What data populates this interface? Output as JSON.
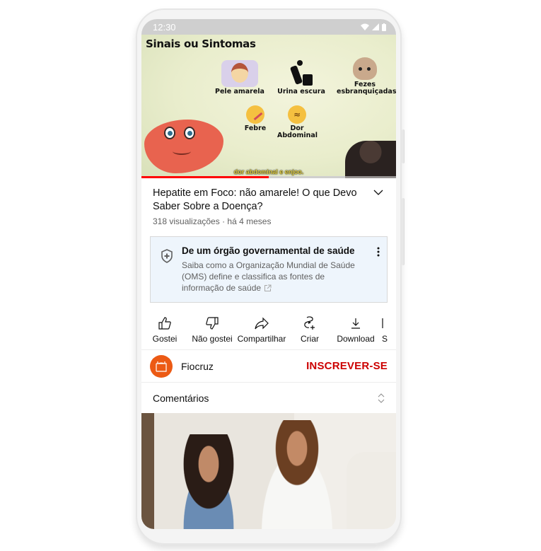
{
  "status_bar": {
    "time": "12:30",
    "icons": [
      "wifi-icon",
      "signal-icon",
      "battery-icon"
    ]
  },
  "video": {
    "slide_title": "Sinais ou Sintomas",
    "symptoms": [
      {
        "label": "Pele amarela",
        "icon": "yellow-skin-illustration"
      },
      {
        "label": "Urina escura",
        "icon": "toilet-person-icon"
      },
      {
        "label_line1": "Fezes",
        "label_line2": "esbranquiçadas",
        "icon": "poop-icon"
      },
      {
        "label": "Febre",
        "icon": "thermometer-face-icon"
      },
      {
        "label_line1": "Dor",
        "label_line2": "Abdominal",
        "icon": "pain-face-icon"
      }
    ],
    "caption": "dor abdominal e enjoo.",
    "progress_played": 0.5,
    "progress_buffered": 0.8,
    "colors": {
      "progress": "#ff0000"
    }
  },
  "info": {
    "title": "Hepatite em Foco: não amarele! O que Devo Saber Sobre a Doença?",
    "views": "318 visualizações",
    "separator": "·",
    "age": "há 4 meses"
  },
  "panel": {
    "title": "De um órgão governamental de saúde",
    "description": "Saiba como a Organização Mundial de Saúde (OMS) define e classifica as fontes de informação de saúde"
  },
  "actions": [
    {
      "label": "Gostei",
      "icon": "thumbs-up-icon"
    },
    {
      "label": "Não gostei",
      "icon": "thumbs-down-icon"
    },
    {
      "label": "Compartilhar",
      "icon": "share-icon"
    },
    {
      "label": "Criar",
      "icon": "create-icon"
    },
    {
      "label": "Download",
      "icon": "download-icon"
    },
    {
      "label": "S",
      "icon": "save-icon"
    }
  ],
  "channel": {
    "name": "Fiocruz",
    "subscribe_label": "INSCREVER-SE",
    "colors": {
      "avatar": "#ec5a14",
      "subscribe": "#cc0000"
    }
  },
  "comments": {
    "label": "Comentários"
  }
}
